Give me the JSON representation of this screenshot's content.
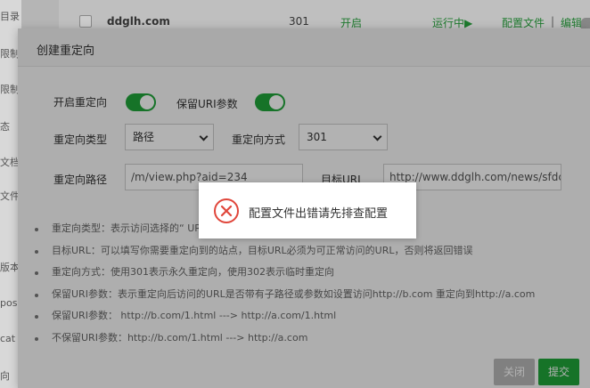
{
  "background": {
    "sidebar_items": [
      "目录",
      "限制",
      "限制",
      "态",
      "文档",
      "文件",
      "版本",
      "pos",
      "cat",
      "向"
    ],
    "row": {
      "domain": "ddglh.com",
      "code": "301",
      "status": "开启",
      "run_state": "运行中▶",
      "config_link": "配置文件",
      "separator": "|",
      "edit_link": "编辑"
    }
  },
  "dialog": {
    "title": "创建重定向",
    "enable_redirect_label": "开启重定向",
    "keep_uri_label": "保留URI参数",
    "redirect_type_label": "重定向类型",
    "redirect_type_value": "路径",
    "redirect_method_label": "重定向方式",
    "redirect_method_value": "301",
    "redirect_path_label": "重定向路径",
    "redirect_path_value": "/m/view.php?aid=234",
    "target_url_label": "目标URL",
    "target_url_value": "http://www.ddglh.com/news/sfdc",
    "tips": [
      "重定向类型：表示访问选择的“                                               URL",
      "目标URL：可以填写你需要重定向到的站点，目标URL必须为可正常访问的URL，否则将返回错误",
      "重定向方式：使用301表示永久重定向，使用302表示临时重定向",
      "保留URI参数：表示重定向后访问的URL是否带有子路径或参数如设置访问http://b.com 重定向到http://a.com",
      "保留URI参数：  http://b.com/1.html ---> http://a.com/1.html",
      "不保留URI参数：http://b.com/1.html ---> http://a.com"
    ],
    "close_button": "关闭",
    "submit_button": "提交"
  },
  "toast": {
    "icon": "error-circle-x-icon",
    "message": "配置文件出错请先排查配置"
  },
  "colors": {
    "accent": "#20a53a",
    "error": "#e0463b"
  }
}
